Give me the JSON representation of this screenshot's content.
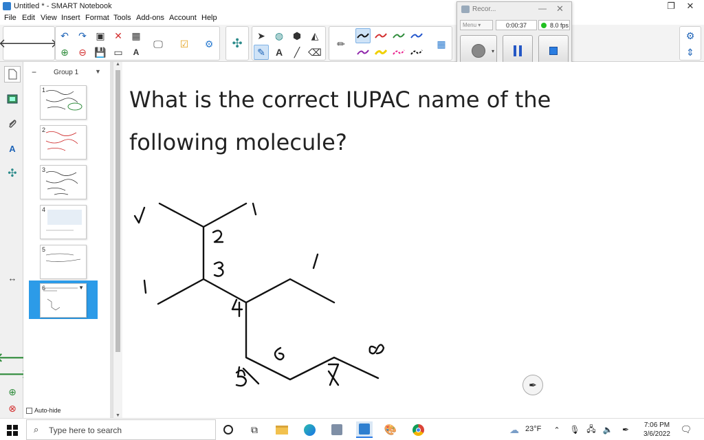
{
  "window": {
    "title": "Untitled * - SMART Notebook"
  },
  "menu": [
    "File",
    "Edit",
    "View",
    "Insert",
    "Format",
    "Tools",
    "Add-ons",
    "Account",
    "Help"
  ],
  "recorder": {
    "title": "Recor...",
    "menu_label": "Menu",
    "elapsed": "0:00:37",
    "fps": "8.0 fps"
  },
  "sorter": {
    "group_label": "Group 1",
    "pages": [
      "1",
      "2",
      "3",
      "4",
      "5",
      "6"
    ],
    "selected_page": "6",
    "autohide_label": "Auto-hide"
  },
  "canvas": {
    "question_line1": "What is the correct IUPAC name of the",
    "question_line2": "following molecule?"
  },
  "taskbar": {
    "search_placeholder": "Type here to search",
    "temperature": "23°F",
    "time": "7:06 PM",
    "date": "3/6/2022"
  },
  "colors": {
    "accent": "#2c9be8",
    "ink": "#111111",
    "recorder_status": "#22c022"
  }
}
